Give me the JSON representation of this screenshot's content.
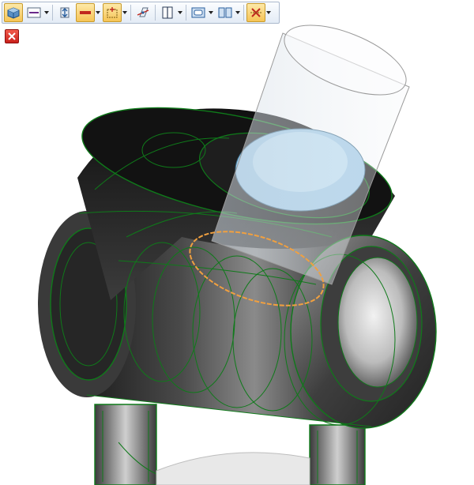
{
  "toolbar": {
    "items": [
      {
        "id": "view-style",
        "icon": "shaded-cube-icon",
        "dropdown": false,
        "active": true
      },
      {
        "id": "line-style",
        "icon": "line-style-icon",
        "dropdown": true
      },
      {
        "id": "view-orient",
        "icon": "orient-arrows-icon",
        "dropdown": false
      },
      {
        "id": "color",
        "icon": "color-bar-icon",
        "dropdown": true
      },
      {
        "id": "snap",
        "icon": "snap-frame-icon",
        "dropdown": true
      },
      {
        "id": "plane",
        "icon": "plane-axis-icon",
        "dropdown": false
      },
      {
        "id": "section",
        "icon": "section-view-icon",
        "dropdown": true
      },
      {
        "id": "display",
        "icon": "display-rect-icon",
        "dropdown": true
      },
      {
        "id": "split",
        "icon": "split-panes-icon",
        "dropdown": true
      },
      {
        "id": "clear",
        "icon": "clear-x-icon",
        "dropdown": true
      }
    ]
  },
  "close_button": {
    "icon": "close-icon"
  },
  "colors": {
    "edge_green": "#0f7a1a",
    "body_dark": "#2a2a2a",
    "hole_blue": "#9cc8e6",
    "highlight_orange": "#f0a040"
  }
}
